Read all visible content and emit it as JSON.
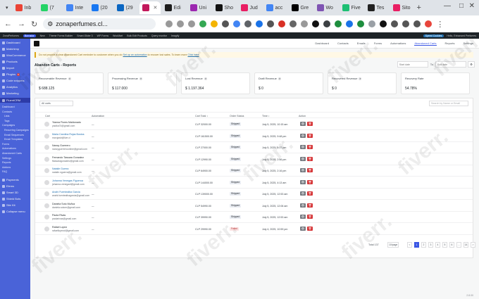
{
  "browser": {
    "tabs": [
      {
        "label": "Inb",
        "color": "#ea4335",
        "active": false
      },
      {
        "label": "(7",
        "color": "#25d366",
        "active": false
      },
      {
        "label": "Inte",
        "color": "#4285f4",
        "active": false
      },
      {
        "label": "(20",
        "color": "#1877f2",
        "active": false
      },
      {
        "label": "(29",
        "color": "#0a66c2",
        "active": false
      },
      {
        "label": "",
        "color": "#c2185b",
        "active": true
      },
      {
        "label": "Edi",
        "color": "#1c1c1c",
        "active": false
      },
      {
        "label": "Uni",
        "color": "#9c27b0",
        "active": false
      },
      {
        "label": "Sho",
        "color": "#111111",
        "active": false
      },
      {
        "label": "Jud",
        "color": "#e91e63",
        "active": false
      },
      {
        "label": "acc",
        "color": "#4285f4",
        "active": false
      },
      {
        "label": "Gre",
        "color": "#000000",
        "active": false
      },
      {
        "label": "Wo",
        "color": "#7f54b3",
        "active": false
      },
      {
        "label": "Five",
        "color": "#1dbf73",
        "active": false
      },
      {
        "label": "Tes",
        "color": "#222222",
        "active": false
      },
      {
        "label": "Sito",
        "color": "#e91e63",
        "active": false
      }
    ],
    "url": "zonaperfumes.cl..."
  },
  "adminbar": {
    "items": [
      "ZonaPerfumes",
      "Borrador",
      "New",
      "Theme Forms Builder",
      "Smart-Slider 3",
      "WP Forms",
      "WooMart",
      "Bulk Edit Products",
      "Query monitor",
      "Imagify"
    ],
    "right_label": "Hello, Enhanced Perfumes",
    "review_label": "Speed Cookies"
  },
  "sidebar": {
    "items": [
      {
        "label": "Dashboard",
        "badge": ""
      },
      {
        "label": "Mailchimp",
        "badge": ""
      },
      {
        "label": "WooCommerce",
        "badge": ""
      },
      {
        "label": "Products",
        "badge": ""
      },
      {
        "label": "Import",
        "badge": ""
      },
      {
        "label": "Plugins",
        "badge": "5"
      },
      {
        "label": "Code snippets",
        "badge": ""
      },
      {
        "label": "Analytics",
        "badge": ""
      },
      {
        "label": "Marketing",
        "badge": ""
      },
      {
        "label": "FluentCRM",
        "badge": ""
      }
    ],
    "sub_items": [
      "Dashboard",
      "Contacts",
      "Lists",
      "Tags",
      "Campaigns",
      "Recurring Campaigns",
      "Email Sequences",
      "Email Templates",
      "Forms",
      "Automations",
      "Abandoned Carts",
      "Settings",
      "Reports",
      "Addons",
      "FAQ"
    ],
    "bottom_items": [
      "Payments",
      "Elems",
      "Smart 3D",
      "Shield Bots",
      "Site Kit",
      "Collapse menu"
    ]
  },
  "topnav": {
    "links": [
      "Dashboard",
      "Contacts",
      "Emails",
      "Forms",
      "Automations",
      "Abandoned Carts",
      "Reports",
      "Settings"
    ],
    "active": "Abandoned Carts"
  },
  "notice": {
    "text": "Do not provide a clear Abandoned Cart reminder to customer when you do",
    "link1": "Set up an automation",
    "middle": "to recover lost sales. To learn more",
    "link2": "Click here"
  },
  "page": {
    "title": "Abandon Carts - Reports",
    "start_placeholder": "Start date",
    "to_label": "To",
    "end_placeholder": "End date"
  },
  "cards": [
    {
      "label": "Recoverable Revenue",
      "value": "$ 688.125"
    },
    {
      "label": "Processing Revenue",
      "value": "$ 117.000"
    },
    {
      "label": "Lost Revenue",
      "value": "$ 1.197.364"
    },
    {
      "label": "Draft Revenue",
      "value": "$ 0"
    },
    {
      "label": "Recovered Revenue",
      "value": "$ 0"
    },
    {
      "label": "Recovery Rate",
      "value": "54.78%"
    }
  ],
  "table": {
    "select_placeholder": "All carts",
    "search_placeholder": "Search by Name or Email",
    "headers": [
      "Cart",
      "Automation",
      "Cart Total",
      "Order Status",
      "Time",
      "Action"
    ],
    "rows": [
      {
        "name": "Yianna Flores Maldonado",
        "email": "yacika74@gmail.com",
        "link": false,
        "automation": "—",
        "total": "CLP 32000.00",
        "status": "Shipped",
        "time": "July 5, 2025, 10:15 am"
      },
      {
        "name": "Maria Carolina Rojas Bustos",
        "email": "mcrojasb@live.cl",
        "link": true,
        "automation": "—",
        "total": "CLP 161500.00",
        "status": "Shipped",
        "time": "July 5, 2025, 9:48 pm"
      },
      {
        "name": "Nancy Guerrero",
        "email": "nancyguerreroonline@gmail.com",
        "link": false,
        "automation": "—",
        "total": "CLP 27000.00",
        "status": "Shipped",
        "time": "July 5, 2025, 5:37 pm"
      },
      {
        "name": "Fernando Tassara Gonzalez",
        "email": "ftassaragonzalez@gmail.com",
        "link": false,
        "automation": "—",
        "total": "CLP 12990.00",
        "status": "Shipped",
        "time": "July 5, 2025, 2:56 pm"
      },
      {
        "name": "Natalie Guerra",
        "email": "natalie.nguerra@gmail.com",
        "link": true,
        "automation": "—",
        "total": "CLP 64900.00",
        "status": "Shipped",
        "time": "July 5, 2025, 2:16 pm"
      },
      {
        "name": "Johanna Venegas Figueroa",
        "email": "johanna.venegasf@gmail.com",
        "link": true,
        "automation": "—",
        "total": "CLP 144000.00",
        "status": "Shipped",
        "time": "July 5, 2025, 4:13 am"
      },
      {
        "name": "Anahi Fuentealba Garcia",
        "email": "anahi.fuentealbagarcia@gmail.com",
        "link": true,
        "automation": "—",
        "total": "CLP 139000.00",
        "status": "Shipped",
        "time": "July 5, 2025, 12:53 am"
      },
      {
        "name": "Daniela Soto Muñoz",
        "email": "daniela.sotom@gmail.com",
        "link": false,
        "automation": "—",
        "total": "CLP 54990.00",
        "status": "Shipped",
        "time": "July 5, 2025, 12:06 am"
      },
      {
        "name": "Paola Rivas",
        "email": "paolarivas@gmail.com",
        "link": false,
        "automation": "—",
        "total": "CLP 39990.00",
        "status": "Shipped",
        "time": "July 5, 2025, 12:53 am"
      },
      {
        "name": "Rafael Lopez",
        "email": "rafaellopezcl@gmail.com",
        "link": false,
        "automation": "—",
        "total": "CLP 29990.00",
        "status": "Failed",
        "time": "July 4, 2025, 10:59 pm"
      }
    ],
    "total_label": "Total 137",
    "per_page": "10/page",
    "pages": [
      "<",
      "1",
      "2",
      "3",
      "4",
      "5",
      "6",
      "...",
      "14",
      ">"
    ],
    "active_page": "1"
  },
  "version": "2.8.00",
  "watermark": "fiverr."
}
